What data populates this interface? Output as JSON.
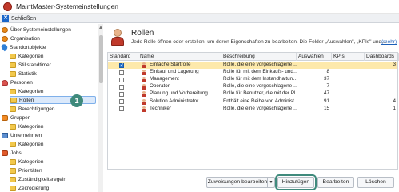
{
  "window": {
    "title": "MaintMaster-Systemeinstellungen"
  },
  "toolbar": {
    "close_label": "Schließen"
  },
  "sidebar": {
    "items": [
      {
        "label": "Über Systemeinstellungen",
        "icon": "gear-icon"
      },
      {
        "label": "Organisation",
        "icon": "gear-icon"
      },
      {
        "label": "Standortobjekte",
        "icon": "pin-icon"
      },
      {
        "label": "Kategorien",
        "icon": "folder-icon"
      },
      {
        "label": "Stillstandtimer",
        "icon": "folder-icon"
      },
      {
        "label": "Statistik",
        "icon": "folder-icon"
      },
      {
        "label": "Personen",
        "icon": "person-icon"
      },
      {
        "label": "Kategorien",
        "icon": "folder-icon"
      },
      {
        "label": "Rollen",
        "icon": "folder-icon"
      },
      {
        "label": "Berechtigungen",
        "icon": "folder-icon"
      },
      {
        "label": "Gruppen",
        "icon": "group-icon"
      },
      {
        "label": "Kategorien",
        "icon": "folder-icon"
      },
      {
        "label": "Unternehmen",
        "icon": "company-icon"
      },
      {
        "label": "Kategorien",
        "icon": "folder-icon"
      },
      {
        "label": "Jobs",
        "icon": "jobs-icon"
      },
      {
        "label": "Kategorien",
        "icon": "folder-icon"
      },
      {
        "label": "Prioritäten",
        "icon": "folder-icon"
      },
      {
        "label": "Zuständigkeitsregeln",
        "icon": "folder-icon"
      },
      {
        "label": "Zeitrodierung",
        "icon": "folder-icon"
      }
    ]
  },
  "callout": {
    "number": "1"
  },
  "main": {
    "title": "Rollen",
    "description": "Jede Rolle öffnen oder erstellen, um deren Eigenschaften zu bearbeiten. Die Felder „Auswahlen\", „KPIs\" und…",
    "more_link": "(mehr)",
    "columns": [
      "Standard",
      "Name",
      "Beschreibung",
      "Auswahlen",
      "KPIs",
      "Dashboards"
    ],
    "rows": [
      {
        "standard": true,
        "name": "Einfache Startrolle",
        "desc": "Rolle, die eine vorgeschlagene …",
        "auswahlen": "",
        "kpis": "",
        "dashboards": "3"
      },
      {
        "standard": false,
        "name": "Einkauf und Lagerung",
        "desc": "Rolle für mit dem Einkaufs- und…",
        "auswahlen": "8",
        "kpis": "",
        "dashboards": ""
      },
      {
        "standard": false,
        "name": "Management",
        "desc": "Rolle für mit dem Instandhaltun…",
        "auswahlen": "37",
        "kpis": "",
        "dashboards": ""
      },
      {
        "standard": false,
        "name": "Operator",
        "desc": "Rolle, die eine vorgeschlagene …",
        "auswahlen": "7",
        "kpis": "",
        "dashboards": ""
      },
      {
        "standard": false,
        "name": "Planung und Vorbereitung",
        "desc": "Rolle für Benutzer, die mit der Pl…",
        "auswahlen": "47",
        "kpis": "",
        "dashboards": ""
      },
      {
        "standard": false,
        "name": "Solution Administrator",
        "desc": "Enthält eine Reihe von Administ…",
        "auswahlen": "91",
        "kpis": "",
        "dashboards": "4"
      },
      {
        "standard": false,
        "name": "Techniker",
        "desc": "Rolle, die eine vorgeschlagene …",
        "auswahlen": "15",
        "kpis": "",
        "dashboards": "1"
      }
    ]
  },
  "buttons": {
    "assign": "Zuweisungen bearbeiten",
    "add": "Hinzufügen",
    "edit": "Bearbeiten",
    "delete": "Löschen"
  },
  "colors": {
    "accent": "#3f8a7c",
    "selected_row": "#fde9ab",
    "link": "#1b5fb8"
  }
}
